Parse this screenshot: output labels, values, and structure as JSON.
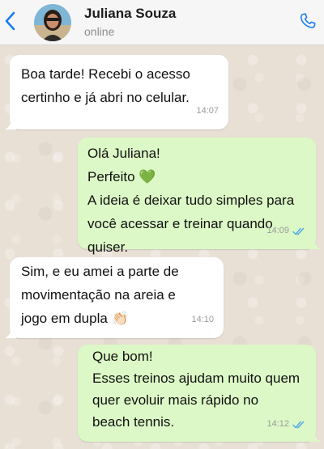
{
  "header": {
    "contact_name": "Juliana Souza",
    "status": "online"
  },
  "messages": [
    {
      "direction": "incoming",
      "text": "Boa tarde! Recebi o acesso\ncertinho e já abri no celular.",
      "time": "14:07"
    },
    {
      "direction": "outgoing",
      "text": "Olá Juliana!\nPerfeito 💚\nA ideia é deixar tudo simples para\nvocê acessar e treinar quando quiser.",
      "time": "14:09",
      "read": true
    },
    {
      "direction": "incoming",
      "text": "Sim, e eu amei a parte de\nmovimentação na areia e\njogo em dupla 👏🏻",
      "time": "14:10"
    },
    {
      "direction": "outgoing",
      "text": "Que bom!\nEsses treinos ajudam muito quem\nquer evoluir mais rápido no\nbeach tennis.",
      "time": "14:12",
      "read": true
    }
  ],
  "colors": {
    "accent": "#1a7cf5",
    "incoming_bubble": "#ffffff",
    "outgoing_bubble": "#dcf8c6",
    "read_ticks": "#4fa7e3",
    "chat_background": "#e8e0d5"
  },
  "icons": {
    "back": "chevron-left-icon",
    "call": "phone-icon",
    "read": "double-check-icon"
  }
}
